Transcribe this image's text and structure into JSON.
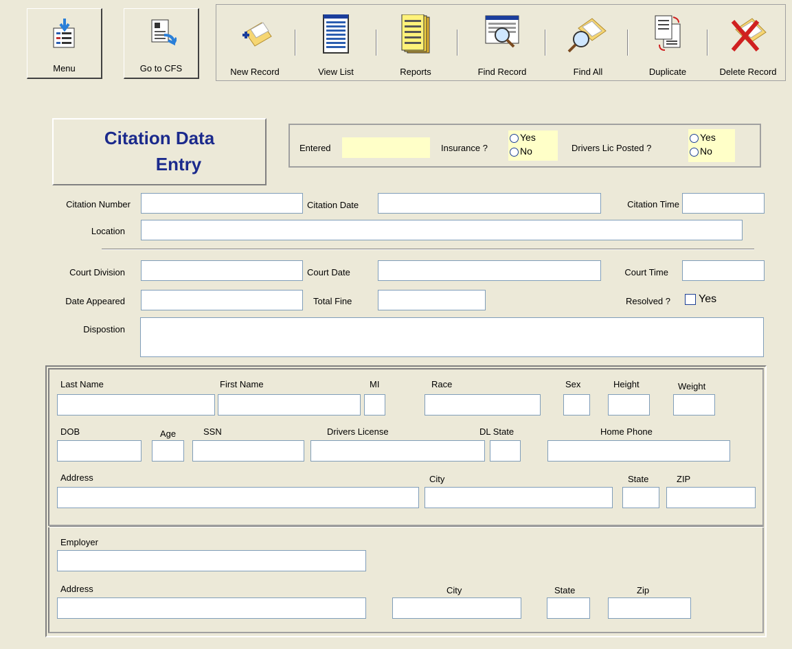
{
  "toolbar": {
    "menu": "Menu",
    "goto_cfs": "Go to CFS",
    "new_record": "New Record",
    "view_list": "View List",
    "reports": "Reports",
    "find_record": "Find Record",
    "find_all": "Find All",
    "duplicate": "Duplicate",
    "delete_record": "Delete Record"
  },
  "title": {
    "line1": "Citation Data",
    "line2": "Entry"
  },
  "status": {
    "entered_label": "Entered",
    "insurance_label": "Insurance ?",
    "drivers_lic_label": "Drivers Lic Posted ?",
    "yes": "Yes",
    "no": "No"
  },
  "citation": {
    "number_label": "Citation Number",
    "date_label": "Citation Date",
    "time_label": "Citation Time",
    "location_label": "Location"
  },
  "court": {
    "division_label": "Court Division",
    "date_label": "Court Date",
    "time_label": "Court Time",
    "date_appeared_label": "Date Appeared",
    "total_fine_label": "Total Fine",
    "resolved_label": "Resolved ?",
    "resolved_yes": "Yes",
    "disposition_label": "Dispostion"
  },
  "person": {
    "last_name": "Last Name",
    "first_name": "First Name",
    "mi": "MI",
    "race": "Race",
    "sex": "Sex",
    "height": "Height",
    "weight": "Weight",
    "dob": "DOB",
    "age": "Age",
    "ssn": "SSN",
    "drivers_license": "Drivers License",
    "dl_state": "DL State",
    "home_phone": "Home Phone",
    "address": "Address",
    "city": "City",
    "state": "State",
    "zip": "ZIP"
  },
  "employer": {
    "employer": "Employer",
    "address": "Address",
    "city": "City",
    "state": "State",
    "zip": "Zip"
  }
}
